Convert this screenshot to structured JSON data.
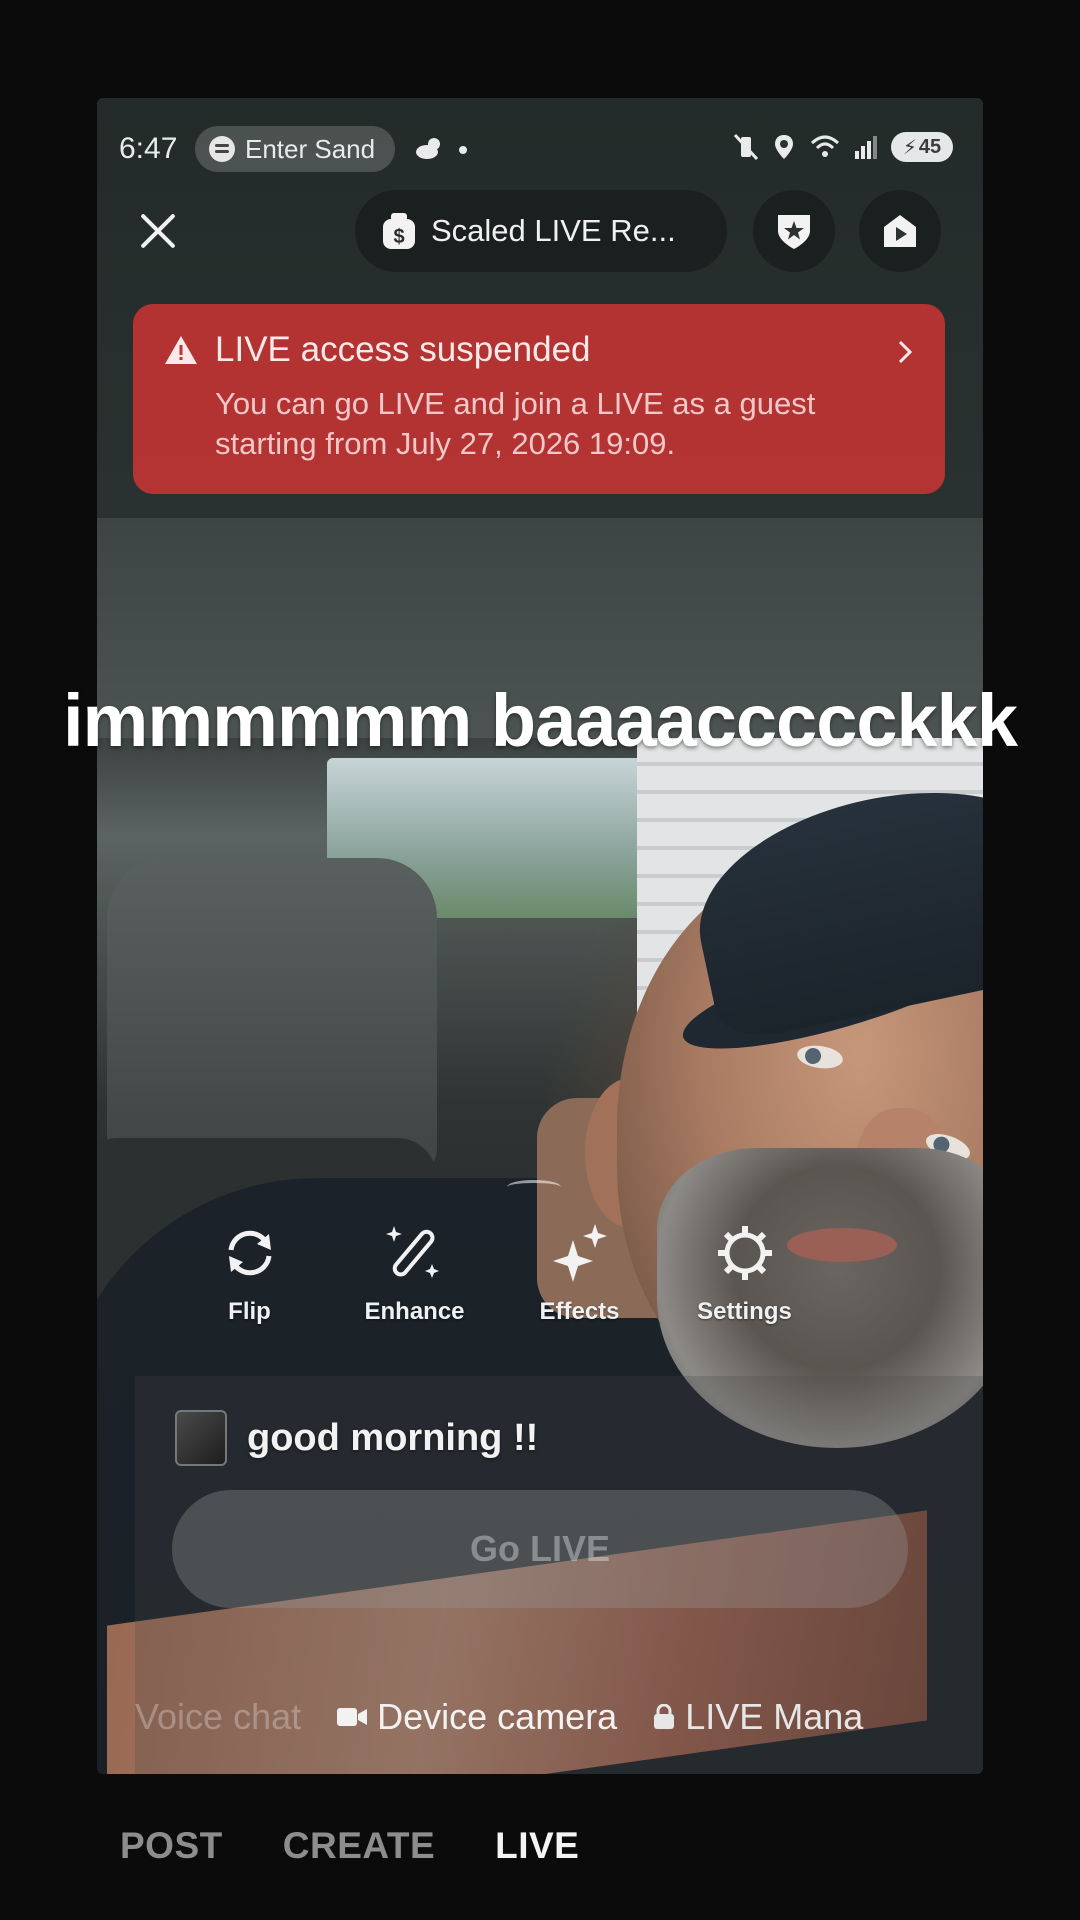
{
  "status_bar": {
    "time": "6:47",
    "media_pill_text": "Enter Sand",
    "battery_level": "45"
  },
  "top_bar": {
    "reward_label": "Scaled LIVE Re..."
  },
  "alert": {
    "title": "LIVE access suspended",
    "body": "You can go LIVE and join a LIVE as a guest starting from July 27, 2026 19:09."
  },
  "caption": "immmmmm baaaaccccckkk",
  "tools": [
    {
      "label": "Flip",
      "icon": "flip-camera-icon"
    },
    {
      "label": "Enhance",
      "icon": "magic-wand-icon"
    },
    {
      "label": "Effects",
      "icon": "sparkles-icon"
    },
    {
      "label": "Settings",
      "icon": "gear-icon"
    }
  ],
  "live_title": "good morning !!",
  "go_live_label": "Go LIVE",
  "modes": [
    {
      "label": "Voice chat",
      "state": "dim"
    },
    {
      "label": "Device camera",
      "state": "active"
    },
    {
      "label": "LIVE Mana",
      "state": "mid"
    }
  ],
  "bottom_tabs": [
    {
      "label": "POST",
      "active": false
    },
    {
      "label": "CREATE",
      "active": false
    },
    {
      "label": "LIVE",
      "active": true
    }
  ],
  "colors": {
    "alert_bg": "#be3434",
    "background": "#0b0b0b"
  }
}
